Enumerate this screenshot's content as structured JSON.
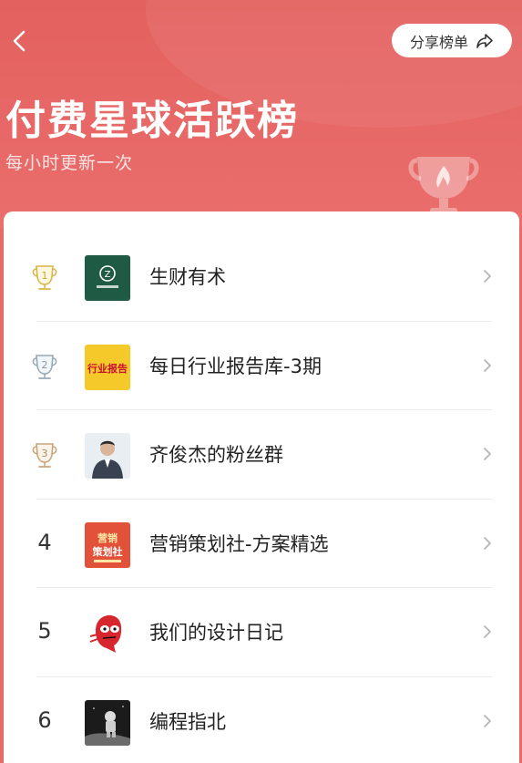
{
  "header": {
    "title": "付费星球活跃榜",
    "subtitle": "每小时更新一次",
    "share_label": "分享榜单",
    "back_icon": "chevron-left-icon",
    "share_icon": "share-arrow-icon",
    "decor_icon": "trophy-icon"
  },
  "colors": {
    "header_bg": "#e3615f",
    "gold": "#d8b64a",
    "silver": "#98aab6",
    "bronze": "#c8a67a"
  },
  "rankings": [
    {
      "rank": "1",
      "name": "生财有术",
      "badge": "gold-trophy-icon"
    },
    {
      "rank": "2",
      "name": "每日行业报告库-3期",
      "badge": "silver-trophy-icon"
    },
    {
      "rank": "3",
      "name": "齐俊杰的粉丝群",
      "badge": "bronze-trophy-icon"
    },
    {
      "rank": "4",
      "name": "营销策划社-方案精选",
      "badge": ""
    },
    {
      "rank": "5",
      "name": "我们的设计日记",
      "badge": ""
    },
    {
      "rank": "6",
      "name": "编程指北",
      "badge": ""
    }
  ],
  "avatar_texts": {
    "item2": "行业报告",
    "item4_top": "营销",
    "item4_bottom": "策划社"
  }
}
